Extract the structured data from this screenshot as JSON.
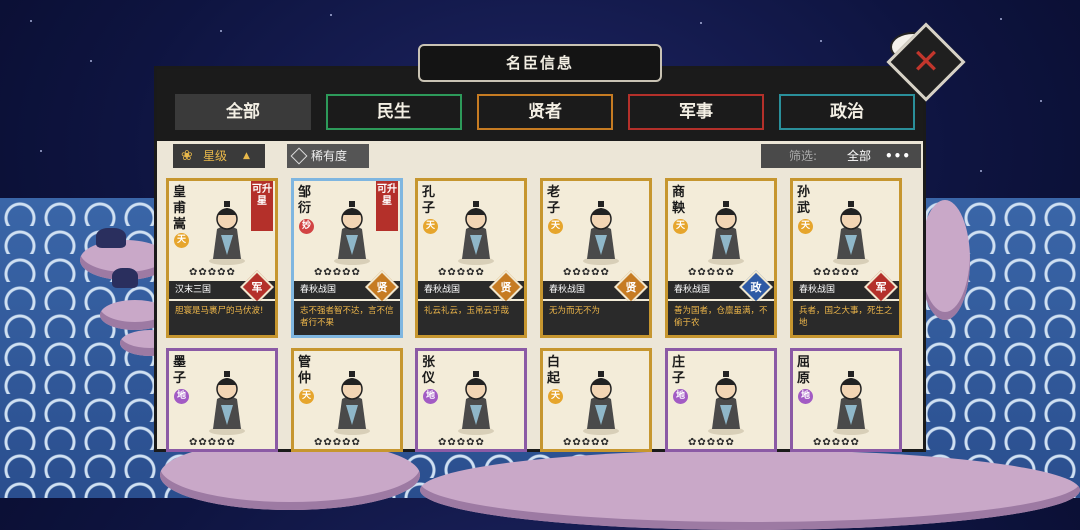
{
  "window": {
    "title": "名臣信息",
    "close_icon": "close-x-icon"
  },
  "tabs": [
    {
      "label": "全部",
      "color": "#3a3a3a",
      "active": true
    },
    {
      "label": "民生",
      "color": "#2d9a5a"
    },
    {
      "label": "贤者",
      "color": "#c67b22"
    },
    {
      "label": "军事",
      "color": "#b4302a"
    },
    {
      "label": "政治",
      "color": "#2a8f9a"
    }
  ],
  "filters": {
    "sort_label": "星级",
    "sort_icon": "flower-icon",
    "rarity_label": "稀有度",
    "filter_label": "筛选:",
    "filter_value": "全部",
    "more_icon": "more-icon"
  },
  "cards": [
    {
      "name": "皇甫嵩",
      "rank": "天",
      "rank_color": "gold",
      "upgrade": "可升星",
      "era": "汉末三国",
      "cat": "军",
      "cat_type": "mil",
      "quote": "胆寰是马裹尸的马伏波!"
    },
    {
      "name": "邹衍",
      "rank": "妙",
      "rank_color": "red",
      "upgrade": "可升星",
      "era": "春秋战国",
      "cat": "贤",
      "cat_type": "sage",
      "quote": "志不强者智不达，言不信者行不果"
    },
    {
      "name": "孔子",
      "rank": "天",
      "rank_color": "gold",
      "upgrade": "",
      "era": "春秋战国",
      "cat": "贤",
      "cat_type": "sage",
      "quote": "礼云礼云，玉帛云乎哉"
    },
    {
      "name": "老子",
      "rank": "天",
      "rank_color": "gold",
      "upgrade": "",
      "era": "春秋战国",
      "cat": "贤",
      "cat_type": "sage",
      "quote": "无为而无不为"
    },
    {
      "name": "商鞅",
      "rank": "天",
      "rank_color": "gold",
      "upgrade": "",
      "era": "春秋战国",
      "cat": "政",
      "cat_type": "pol",
      "quote": "善为国者，仓廪虽满，不偷于农"
    },
    {
      "name": "孙武",
      "rank": "天",
      "rank_color": "gold",
      "upgrade": "",
      "era": "春秋战国",
      "cat": "军",
      "cat_type": "mil",
      "quote": "兵者，国之大事，死生之地"
    },
    {
      "name": "墨子",
      "rank": "地",
      "rank_color": "purple"
    },
    {
      "name": "管仲",
      "rank": "天",
      "rank_color": "gold"
    },
    {
      "name": "张仪",
      "rank": "地",
      "rank_color": "purple"
    },
    {
      "name": "白起",
      "rank": "天",
      "rank_color": "gold"
    },
    {
      "name": "庄子",
      "rank": "地",
      "rank_color": "purple"
    },
    {
      "name": "屈原",
      "rank": "地",
      "rank_color": "purple"
    }
  ]
}
